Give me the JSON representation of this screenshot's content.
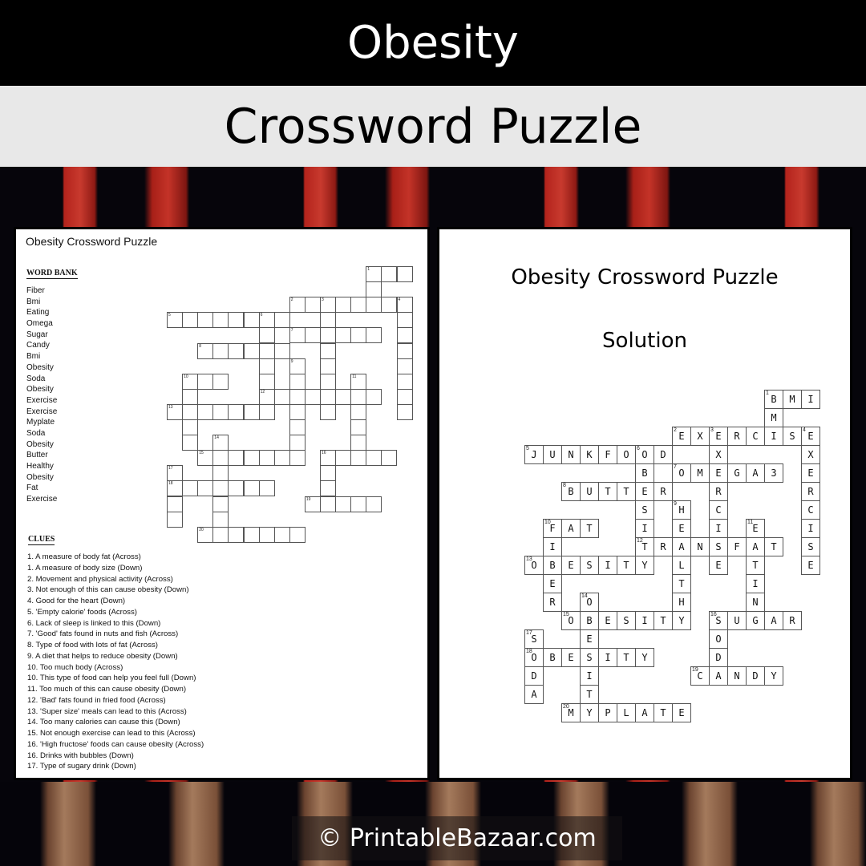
{
  "header": {
    "topic": "Obesity",
    "subtitle": "Crossword Puzzle"
  },
  "puzzle_page": {
    "title": "Obesity Crossword Puzzle",
    "word_bank_title": "WORD BANK",
    "word_bank": [
      "Fiber",
      "Bmi",
      "Eating",
      "Omega",
      "Sugar",
      "Candy",
      "Bmi",
      "Obesity",
      "Soda",
      "Obesity",
      "Exercise",
      "Exercise",
      "Myplate",
      "Soda",
      "Obesity",
      "Butter",
      "Healthy",
      "Obesity",
      "Fat",
      "Exercise"
    ],
    "clues_title": "CLUES",
    "clues": [
      "1. A measure of body fat (Across)",
      "1. A measure of body size (Down)",
      "2. Movement  and physical activity (Across)",
      "3. Not enough of this can cause obesity (Down)",
      "4. Good for the heart (Down)",
      "5. 'Empty calorie' foods (Across)",
      "6. Lack of sleep is linked to this (Down)",
      "7. 'Good' fats found in nuts and fish (Across)",
      "8. Type of food with lots of fat (Across)",
      "9. A diet that helps to reduce obesity (Down)",
      "10. Too much body (Across)",
      "10. This type of food can help you feel full (Down)",
      "11. Too much of this can cause obesity (Down)",
      "12. 'Bad' fats found in fried food (Across)",
      "13. 'Super size' meals can lead to this (Across)",
      "14. Too many calories can cause this (Down)",
      "15. Not enough exercise can lead to this (Across)",
      "16. 'High fructose' foods can cause obesity (Across)",
      "16. Drinks with bubbles (Down)",
      "17. Type of sugary drink (Down)"
    ]
  },
  "solution_page": {
    "title": "Obesity Crossword Puzzle",
    "subtitle": "Solution"
  },
  "crossword": {
    "entries": [
      {
        "num": "1",
        "dir": "across",
        "row": 0,
        "col": 13,
        "answer": "BMI"
      },
      {
        "num": "1",
        "dir": "down",
        "row": 0,
        "col": 13,
        "answer": "BMI"
      },
      {
        "num": "2",
        "dir": "across",
        "row": 2,
        "col": 8,
        "answer": "EXERCISE"
      },
      {
        "num": "3",
        "dir": "down",
        "row": 2,
        "col": 10,
        "answer": "EXERCISE"
      },
      {
        "num": "4",
        "dir": "down",
        "row": 2,
        "col": 15,
        "answer": "EXERCISE"
      },
      {
        "num": "5",
        "dir": "across",
        "row": 3,
        "col": 0,
        "answer": "JUNKFOOD"
      },
      {
        "num": "6",
        "dir": "down",
        "row": 3,
        "col": 6,
        "answer": "OBESITY"
      },
      {
        "num": "7",
        "dir": "across",
        "row": 4,
        "col": 8,
        "answer": "OMEGA3"
      },
      {
        "num": "8",
        "dir": "across",
        "row": 5,
        "col": 2,
        "answer": "BUTTER"
      },
      {
        "num": "9",
        "dir": "down",
        "row": 6,
        "col": 8,
        "answer": "HEALTHY"
      },
      {
        "num": "10",
        "dir": "across",
        "row": 7,
        "col": 1,
        "answer": "FAT"
      },
      {
        "num": "10",
        "dir": "down",
        "row": 7,
        "col": 1,
        "answer": "FIBER"
      },
      {
        "num": "11",
        "dir": "down",
        "row": 7,
        "col": 12,
        "answer": "EATING"
      },
      {
        "num": "12",
        "dir": "across",
        "row": 8,
        "col": 6,
        "answer": "TRANSFAT"
      },
      {
        "num": "13",
        "dir": "across",
        "row": 9,
        "col": 0,
        "answer": "OBESITY"
      },
      {
        "num": "14",
        "dir": "down",
        "row": 11,
        "col": 3,
        "answer": "OBESITY"
      },
      {
        "num": "15",
        "dir": "across",
        "row": 12,
        "col": 2,
        "answer": "OBESITY"
      },
      {
        "num": "16",
        "dir": "across",
        "row": 12,
        "col": 10,
        "answer": "SUGAR"
      },
      {
        "num": "16",
        "dir": "down",
        "row": 12,
        "col": 10,
        "answer": "SODA"
      },
      {
        "num": "17",
        "dir": "down",
        "row": 13,
        "col": 0,
        "answer": "SODA"
      },
      {
        "num": "18",
        "dir": "across",
        "row": 14,
        "col": 0,
        "answer": "OBESITY"
      },
      {
        "num": "19",
        "dir": "across",
        "row": 15,
        "col": 9,
        "answer": "CANDY"
      },
      {
        "num": "20",
        "dir": "across",
        "row": 17,
        "col": 2,
        "answer": "MYPLATE"
      }
    ]
  },
  "footer": {
    "copyright": "© PrintableBazaar.com"
  }
}
